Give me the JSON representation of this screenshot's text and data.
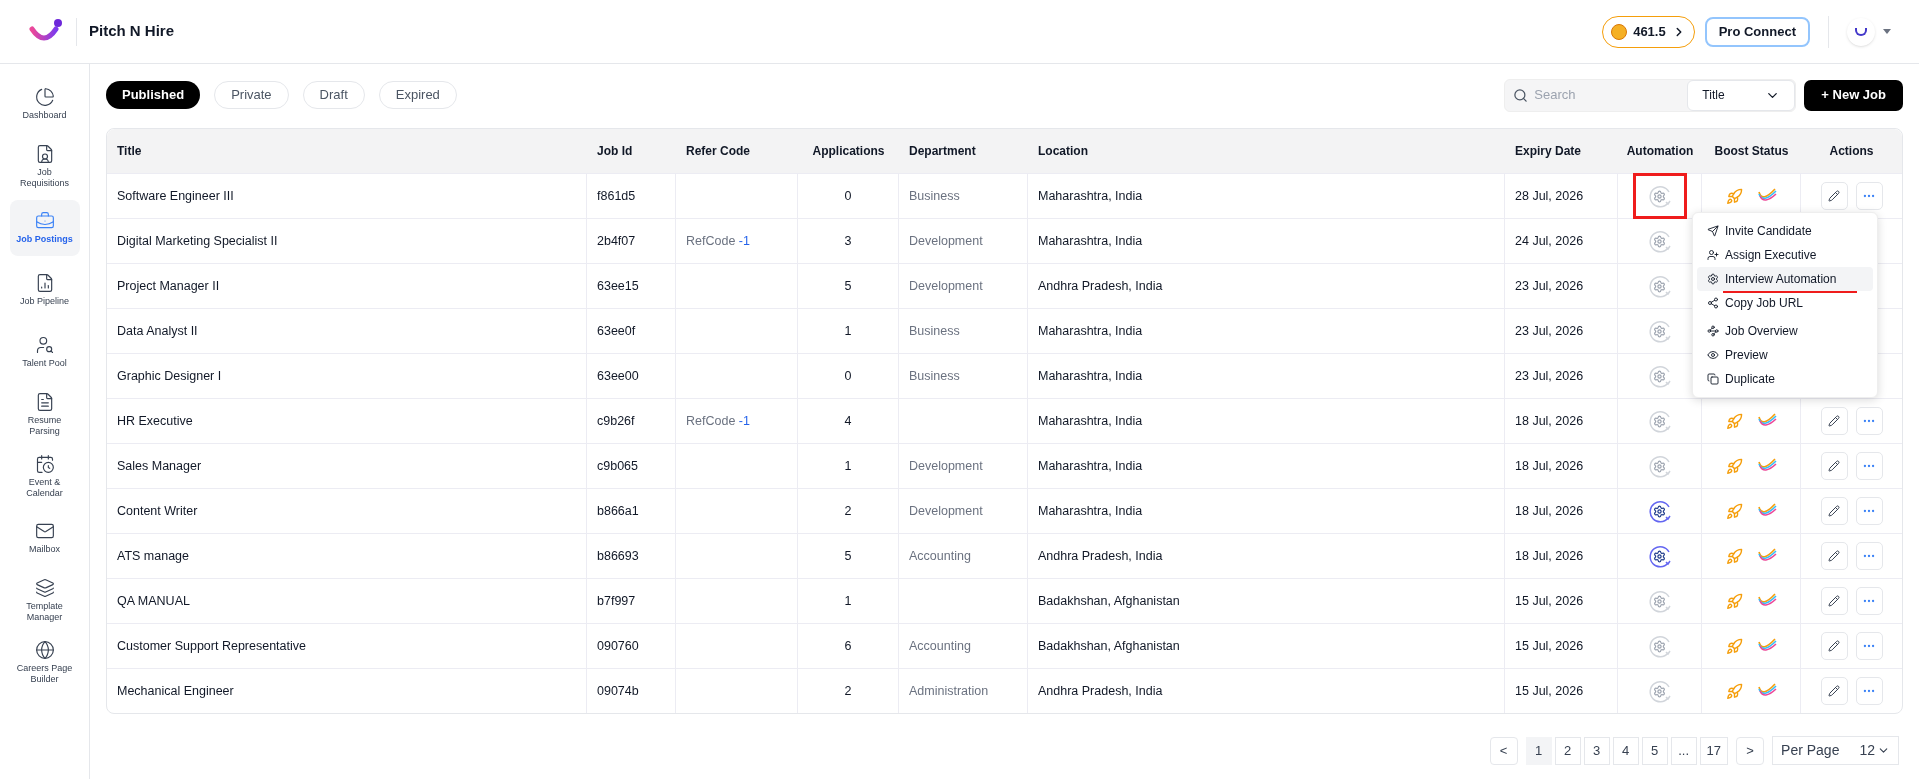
{
  "header": {
    "brand": "Pitch N Hire",
    "credits": "461.5",
    "pro_button": "Pro Connect"
  },
  "sidebar": {
    "items": [
      {
        "label": "Dashboard",
        "selected": false
      },
      {
        "label": "Job Requisitions",
        "selected": false
      },
      {
        "label": "Job Postings",
        "selected": true
      },
      {
        "label": "Job Pipeline",
        "selected": false
      },
      {
        "label": "Talent Pool",
        "selected": false
      },
      {
        "label": "Resume Parsing",
        "selected": false
      },
      {
        "label": "Event & Calendar",
        "selected": false
      },
      {
        "label": "Mailbox",
        "selected": false
      },
      {
        "label": "Template Manager",
        "selected": false
      },
      {
        "label": "Careers Page Builder",
        "selected": false
      }
    ]
  },
  "tabs": [
    {
      "label": "Published",
      "selected": true
    },
    {
      "label": "Private",
      "selected": false
    },
    {
      "label": "Draft",
      "selected": false
    },
    {
      "label": "Expired",
      "selected": false
    }
  ],
  "search": {
    "placeholder": "Search",
    "filter": "Title"
  },
  "new_job_button": "+ New Job",
  "table": {
    "columns": [
      "Title",
      "Job Id",
      "Refer Code",
      "Applications",
      "Department",
      "Location",
      "Expiry Date",
      "Automation",
      "Boost Status",
      "Actions"
    ],
    "rows": [
      {
        "title": "Software Engineer III",
        "job_id": "f861d5",
        "applications": "0",
        "department": "Business",
        "location": "Maharashtra, India",
        "expiry": "28 Jul, 2026",
        "automation": false,
        "menu_open": true
      },
      {
        "title": "Digital Marketing Specialist II",
        "job_id": "2b4f07",
        "refer_code": "RefCode",
        "refer_suffix": "-1",
        "applications": "3",
        "department": "Development",
        "location": "Maharashtra, India",
        "expiry": "24 Jul, 2026",
        "automation": false
      },
      {
        "title": "Project Manager II",
        "job_id": "63ee15",
        "applications": "5",
        "department": "Development",
        "location": "Andhra Pradesh, India",
        "expiry": "23 Jul, 2026",
        "automation": false
      },
      {
        "title": "Data Analyst II",
        "job_id": "63ee0f",
        "applications": "1",
        "department": "Business",
        "location": "Maharashtra, India",
        "expiry": "23 Jul, 2026",
        "automation": false
      },
      {
        "title": "Graphic Designer I",
        "job_id": "63ee00",
        "applications": "0",
        "department": "Business",
        "location": "Maharashtra, India",
        "expiry": "23 Jul, 2026",
        "automation": false
      },
      {
        "title": "HR Executive",
        "job_id": "c9b26f",
        "refer_code": "RefCode",
        "refer_suffix": "-1",
        "applications": "4",
        "location": "Maharashtra, India",
        "expiry": "18 Jul, 2026",
        "automation": false
      },
      {
        "title": "Sales Manager",
        "job_id": "c9b065",
        "applications": "1",
        "department": "Development",
        "location": "Maharashtra, India",
        "expiry": "18 Jul, 2026",
        "automation": false
      },
      {
        "title": "Content Writer",
        "job_id": "b866a1",
        "applications": "2",
        "department": "Development",
        "location": "Maharashtra, India",
        "expiry": "18 Jul, 2026",
        "automation": true
      },
      {
        "title": "ATS manage",
        "job_id": "b86693",
        "applications": "5",
        "department": "Accounting",
        "location": "Andhra Pradesh, India",
        "expiry": "18 Jul, 2026",
        "automation": true
      },
      {
        "title": "QA MANUAL",
        "job_id": "b7f997",
        "applications": "1",
        "location": "Badakhshan, Afghanistan",
        "expiry": "15 Jul, 2026",
        "automation": false
      },
      {
        "title": "Customer Support Representative",
        "job_id": "090760",
        "applications": "6",
        "department": "Accounting",
        "location": "Badakhshan, Afghanistan",
        "expiry": "15 Jul, 2026",
        "automation": false
      },
      {
        "title": "Mechanical Engineer",
        "job_id": "09074b",
        "applications": "2",
        "department": "Administration",
        "location": "Andhra Pradesh, India",
        "expiry": "15 Jul, 2026",
        "automation": false
      }
    ]
  },
  "action_menu": {
    "items": [
      {
        "label": "Invite Candidate",
        "selected": false
      },
      {
        "label": "Assign Executive",
        "selected": false
      },
      {
        "label": "Interview Automation",
        "selected": true
      },
      {
        "label": "Copy Job URL",
        "selected": false
      },
      {
        "label": "Job Overview",
        "selected": false
      },
      {
        "label": "Preview",
        "selected": false
      },
      {
        "label": "Duplicate",
        "selected": false
      }
    ]
  },
  "pagination": {
    "prev": "<",
    "pages": [
      {
        "label": "1",
        "selected": true
      },
      {
        "label": "2",
        "selected": false
      },
      {
        "label": "3",
        "selected": false
      },
      {
        "label": "4",
        "selected": false
      },
      {
        "label": "5",
        "selected": false
      },
      {
        "label": "...",
        "selected": false
      },
      {
        "label": "17",
        "selected": false
      }
    ],
    "next": ">",
    "per_page_label": "Per Page",
    "per_page": "12"
  }
}
